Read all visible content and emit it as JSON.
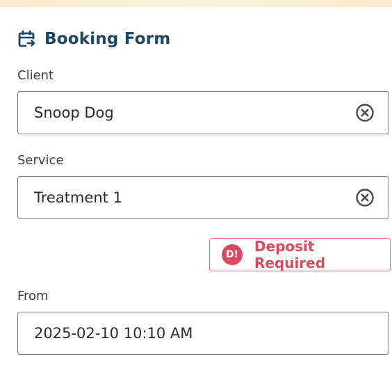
{
  "form": {
    "title": "Booking Form",
    "title_icon": "calendar-arrow-icon"
  },
  "client": {
    "label": "Client",
    "value": "Snoop Dog",
    "clear_icon": "clear-circle-icon"
  },
  "service": {
    "label": "Service",
    "value": "Treatment 1",
    "clear_icon": "clear-circle-icon"
  },
  "deposit": {
    "badge": "D!",
    "text": "Deposit Required"
  },
  "from": {
    "label": "From",
    "value": "2025-02-10 10:10 AM"
  },
  "colors": {
    "title": "#1f4560",
    "deposit_accent": "#d94a5f",
    "top_strip": "#f6ecd0"
  }
}
